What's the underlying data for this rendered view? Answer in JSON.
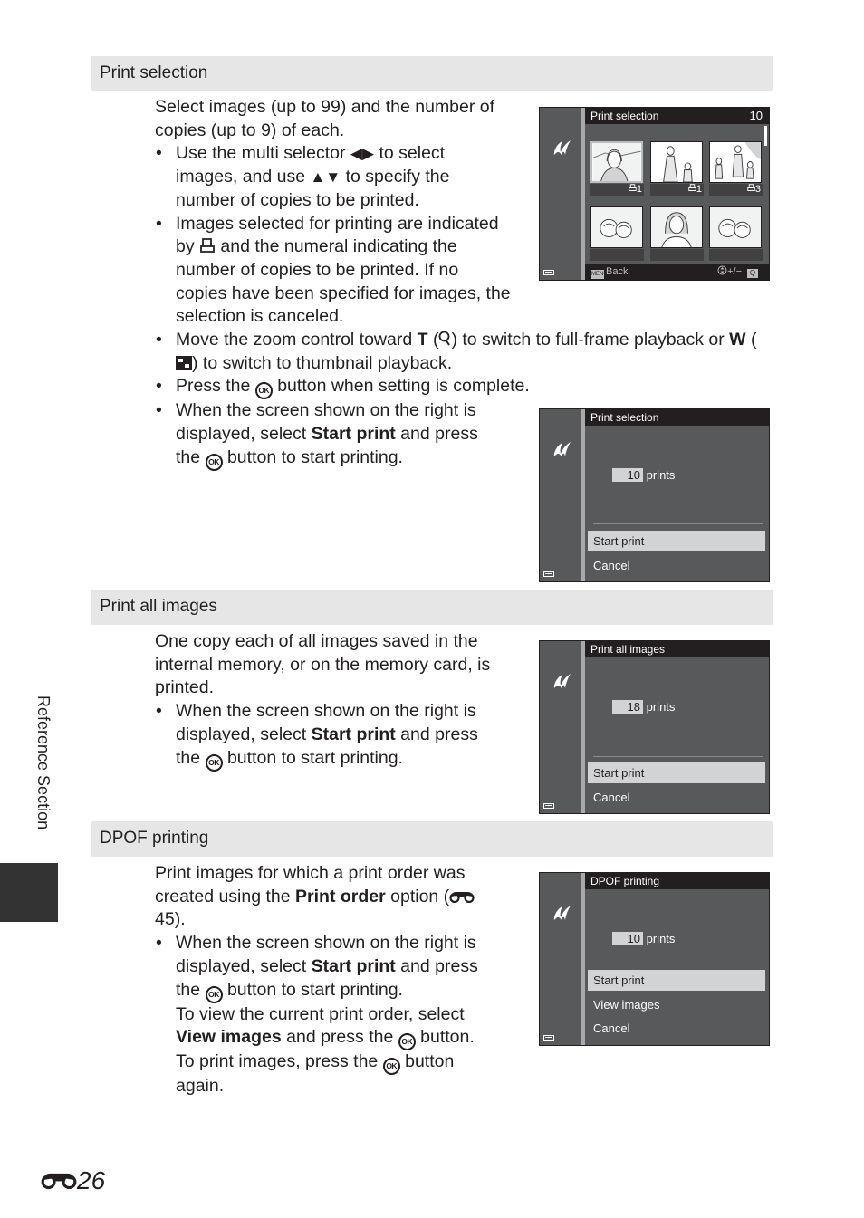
{
  "sections": {
    "print_selection": {
      "heading": "Print selection",
      "intro": "Select images (up to 99) and the number of copies (up to 9) of each.",
      "bullets": {
        "b1_pre": "Use the multi selector ",
        "b1_lr": "◀▶",
        "b1_mid": " to select images, and use ",
        "b1_ud": "▲▼",
        "b1_post": " to specify the number of copies to be printed.",
        "b2_pre": "Images selected for printing are indicated by ",
        "b2_post": " and the numeral indicating the number of copies to be printed. If no copies have been specified for images, the selection is canceled.",
        "b3_pre": "Move the zoom control toward ",
        "b3_t": "T",
        "b3_mid1": " (",
        "b3_mid2": ") to switch to full-frame playback or ",
        "b3_w": "W",
        "b3_mid3": " (",
        "b3_post": ") to switch to thumbnail playback.",
        "b4_pre": "Press the ",
        "b4_post": " button when setting is complete.",
        "b5_pre": "When the screen shown on the right is displayed, select ",
        "b5_bold": "Start print",
        "b5_mid": " and press the ",
        "b5_post": " button to start printing."
      },
      "screen1": {
        "title": "Print selection",
        "count": "10",
        "thumb_counts": [
          "1",
          "1",
          "3"
        ],
        "back_label": "Back",
        "menu_key": "MENU",
        "adjust_label": "+/−"
      },
      "screen2": {
        "title": "Print selection",
        "prints_value": "10",
        "prints_label": "prints",
        "options": [
          "Start print",
          "Cancel"
        ]
      }
    },
    "print_all": {
      "heading": "Print all images",
      "intro": "One copy each of all images saved in the internal memory, or on the memory card, is printed.",
      "b1_pre": "When the screen shown on the right is displayed, select ",
      "b1_bold": "Start print",
      "b1_mid": " and press the ",
      "b1_post": " button to start printing.",
      "screen": {
        "title": "Print all images",
        "prints_value": "18",
        "prints_label": "prints",
        "options": [
          "Start print",
          "Cancel"
        ]
      }
    },
    "dpof": {
      "heading": "DPOF printing",
      "intro_pre": "Print images for which a print order was created using the ",
      "intro_bold": "Print order",
      "intro_mid": " option (",
      "intro_ref": "45",
      "intro_post": ").",
      "b1_pre": "When the screen shown on the right is displayed, select ",
      "b1_bold": "Start print",
      "b1_mid": " and press the ",
      "b1_post": " button to start printing.",
      "b1_l2_pre": "To view the current print order, select ",
      "b1_l2_bold": "View images",
      "b1_l2_mid": " and press the ",
      "b1_l2_post": " button.",
      "b1_l3_pre": "To print images, press the ",
      "b1_l3_post": " button again.",
      "screen": {
        "title": "DPOF printing",
        "prints_value": "10",
        "prints_label": "prints",
        "options": [
          "Start print",
          "View images",
          "Cancel"
        ]
      }
    }
  },
  "ok_label": "OK",
  "side_tab": "Reference Section",
  "page_number": "26"
}
